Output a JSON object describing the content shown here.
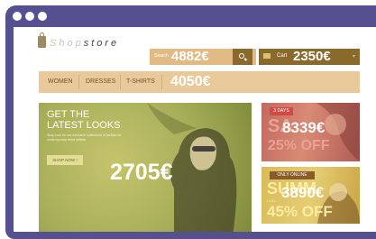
{
  "window": {
    "dots": [
      "dot-1",
      "dot-2",
      "dot-3"
    ],
    "frame_color": "#55508f"
  },
  "logo": {
    "part1": "Shop",
    "part2": "store"
  },
  "search": {
    "placeholder": "Search",
    "price": "4882€",
    "button_icon": "search-icon"
  },
  "cart": {
    "label": "Cart",
    "price": "2350€",
    "icon": "cart-icon",
    "chevron": "chevron-down-icon"
  },
  "nav": {
    "items": [
      {
        "label": "WOMEN"
      },
      {
        "label": "DRESSES"
      },
      {
        "label": "T-SHIRTS"
      }
    ],
    "price": "4050€"
  },
  "hero": {
    "title_line1": "GET THE",
    "title_line2": "LATEST LOOKS",
    "description": "Shop now for our exclusive collections of fashion for contemporary trend setters.",
    "button": "SHOP NOW !",
    "price": "2705€"
  },
  "banner_sale": {
    "tag": "3 DAYS",
    "big1": "SA",
    "big2": "25% OFF",
    "price": "8339€"
  },
  "banner_summer": {
    "tag": "ONLY ONLINE",
    "big1": "SUMM",
    "small": "COLL",
    "big2": "45% OFF",
    "price": "3890€"
  },
  "colors": {
    "accent_light": "#e9c99a",
    "accent_dark": "#8a6a2c",
    "hero_tint": "#a6b05a"
  }
}
